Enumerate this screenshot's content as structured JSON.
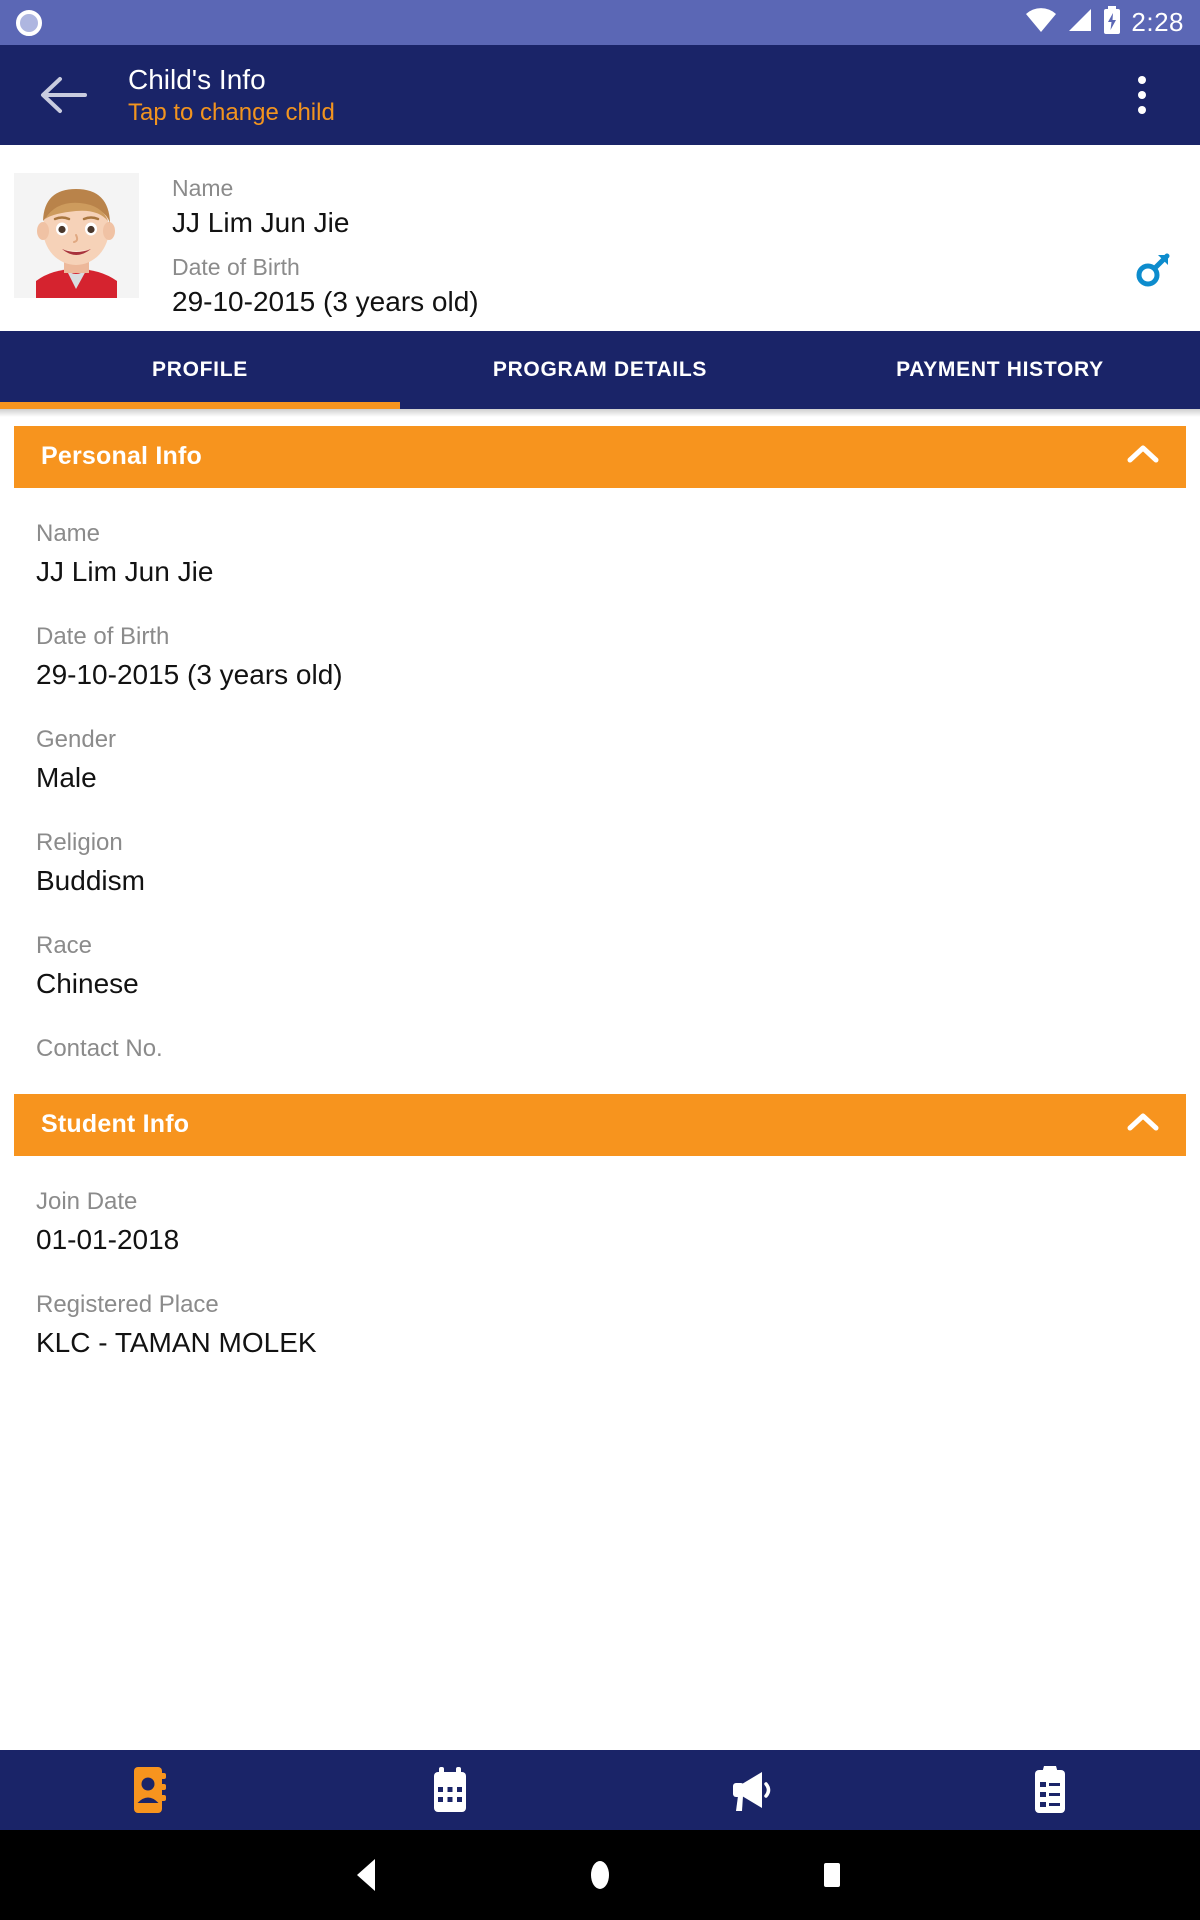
{
  "status_bar": {
    "time": "2:28",
    "notification_icon": "circle-notification-icon",
    "wifi_icon": "wifi-icon",
    "signal_icon": "cell-signal-icon",
    "battery_icon": "battery-charging-icon",
    "background_color": "#5b67b5"
  },
  "app_bar": {
    "back_icon": "arrow-left-icon",
    "title": "Child's Info",
    "subtitle": "Tap to change child",
    "overflow_icon": "more-vertical-icon",
    "background_color": "#1a2468",
    "subtitle_color": "#f2941f"
  },
  "child_summary": {
    "photo_alt": "child-photo",
    "name_label": "Name",
    "name_value": "JJ Lim Jun Jie",
    "dob_label": "Date of Birth",
    "dob_value": "29-10-2015 (3 years old)",
    "gender_icon": "male-gender-icon",
    "gender_icon_color": "#0d8ccd"
  },
  "tabs": {
    "items": [
      {
        "label": "PROFILE",
        "selected": true
      },
      {
        "label": "PROGRAM DETAILS",
        "selected": false
      },
      {
        "label": "PAYMENT HISTORY",
        "selected": false
      }
    ],
    "indicator_color": "#f7941e"
  },
  "sections": [
    {
      "title": "Personal Info",
      "collapse_icon": "chevron-up-icon",
      "fields": [
        {
          "label": "Name",
          "value": "JJ Lim Jun Jie"
        },
        {
          "label": "Date of Birth",
          "value": "29-10-2015 (3 years old)"
        },
        {
          "label": "Gender",
          "value": "Male"
        },
        {
          "label": "Religion",
          "value": "Buddism"
        },
        {
          "label": "Race",
          "value": "Chinese"
        },
        {
          "label": "Contact No.",
          "value": ""
        }
      ]
    },
    {
      "title": "Student Info",
      "collapse_icon": "chevron-up-icon",
      "fields": [
        {
          "label": "Join Date",
          "value": "01-01-2018"
        },
        {
          "label": "Registered Place",
          "value": "KLC - TAMAN MOLEK"
        }
      ]
    }
  ],
  "bottom_nav": {
    "items": [
      {
        "icon": "contact-book-icon",
        "selected": true
      },
      {
        "icon": "calendar-icon",
        "selected": false
      },
      {
        "icon": "megaphone-icon",
        "selected": false
      },
      {
        "icon": "clipboard-icon",
        "selected": false
      }
    ],
    "active_color": "#f7941e",
    "inactive_color": "#ffffff"
  },
  "system_nav": {
    "back_icon": "android-back-icon",
    "home_icon": "android-home-icon",
    "recents_icon": "android-recents-icon"
  },
  "theme": {
    "navy": "#1a2468",
    "orange": "#f7941e",
    "label_gray": "#8b8b8b"
  }
}
